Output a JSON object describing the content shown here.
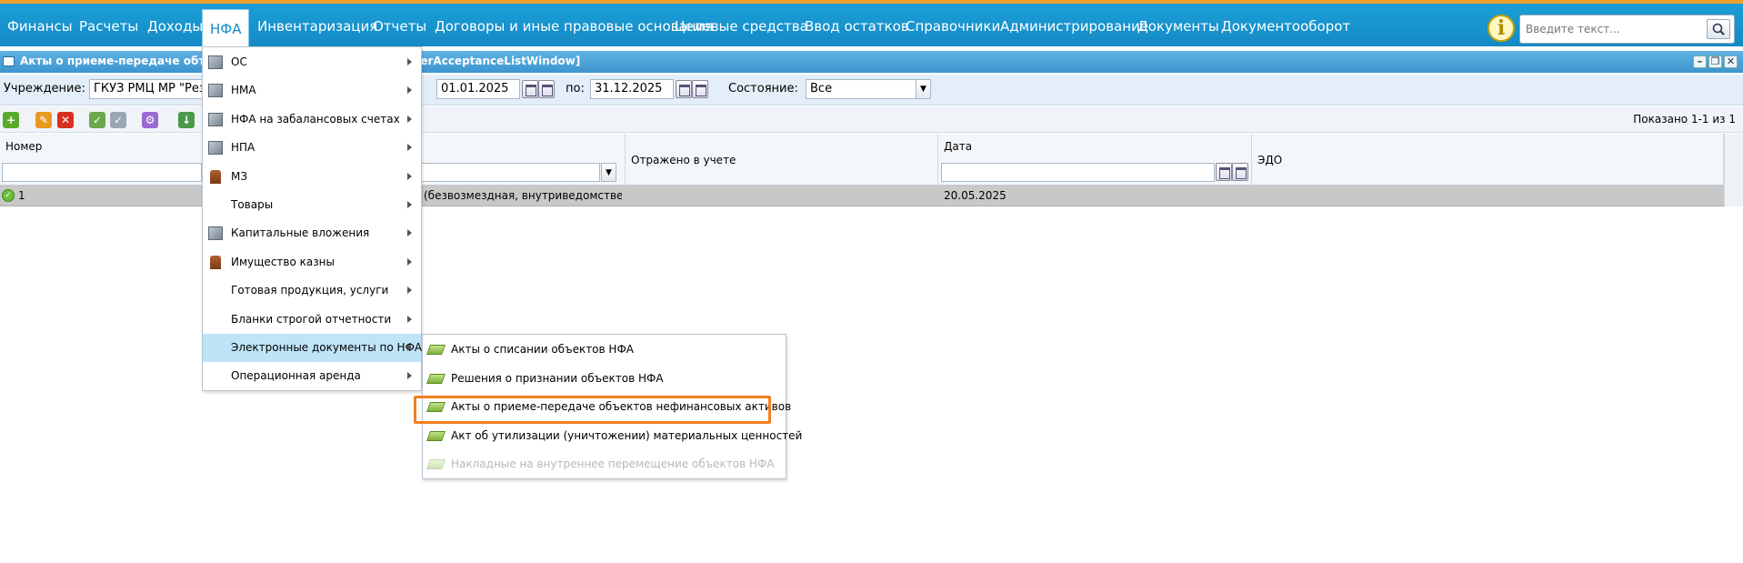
{
  "topnav": {
    "items": [
      "Финансы",
      "Расчеты",
      "Доходы",
      "НФА",
      "Инвентаризация",
      "Отчеты",
      "Договоры и иные правовые основания",
      "Целевые средства",
      "Ввод остатков",
      "Справочники",
      "Администрирование",
      "Документы",
      "Документооборот"
    ],
    "active_index": 3,
    "search_placeholder": "Введите текст..."
  },
  "window": {
    "title_left": "Акты о приеме-передаче объе",
    "title_right": "sferAcceptanceListWindow]"
  },
  "filters": {
    "institution_label": "Учреждение:",
    "institution_value": "ГКУЗ РМЦ МР \"Резе",
    "date_from": "01.01.2025",
    "to_label": "по:",
    "date_to": "31.12.2025",
    "state_label": "Состояние:",
    "state_value": "Все"
  },
  "toolbar": {
    "shown": "Показано 1-1 из 1"
  },
  "grid": {
    "columns": [
      "Номер",
      "Отражено в учете",
      "Дата",
      "ЭДО"
    ],
    "rows": [
      {
        "number": "1",
        "type": "(безвозмездная, внутриведомствен...",
        "reflected": "",
        "date": "20.05.2025",
        "edo": ""
      }
    ]
  },
  "menu": {
    "items": [
      {
        "label": "ОС",
        "icon": "box-icon"
      },
      {
        "label": "НМА",
        "icon": "box-icon"
      },
      {
        "label": "НФА на забалансовых счетах",
        "icon": "box-icon"
      },
      {
        "label": "НПА",
        "icon": "box-icon"
      },
      {
        "label": "МЗ",
        "icon": "chair-icon"
      },
      {
        "label": "Товары",
        "icon": ""
      },
      {
        "label": "Капитальные вложения",
        "icon": "box-icon"
      },
      {
        "label": "Имущество казны",
        "icon": "chair-icon"
      },
      {
        "label": "Готовая продукция, услуги",
        "icon": ""
      },
      {
        "label": "Бланки строгой отчетности",
        "icon": ""
      },
      {
        "label": "Электронные документы по НФА",
        "icon": ""
      },
      {
        "label": "Операционная аренда",
        "icon": ""
      }
    ],
    "active_index": 10
  },
  "submenu": {
    "items": [
      {
        "label": "Акты о списании объектов НФА",
        "disabled": false
      },
      {
        "label": "Решения о признании объектов НФА",
        "disabled": false
      },
      {
        "label": "Акты о приеме-передаче объектов нефинансовых активов",
        "disabled": false
      },
      {
        "label": "Акт об утилизации (уничтожении) материальных ценностей",
        "disabled": false
      },
      {
        "label": "Накладные на внутреннее перемещение объектов НФА",
        "disabled": true
      }
    ],
    "highlighted_index": 2,
    "highlight_color": "#f08020"
  }
}
